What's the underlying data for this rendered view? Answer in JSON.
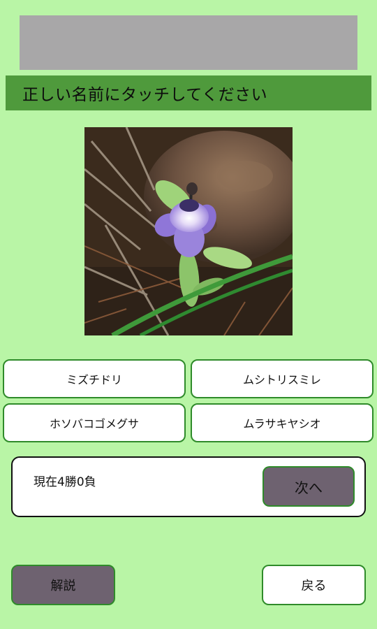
{
  "prompt": "正しい名前にタッチしてください",
  "choices": [
    "ミズチドリ",
    "ムシトリスミレ",
    "ホソバコゴメグサ",
    "ムラサキヤシオ"
  ],
  "result": {
    "text": "現在4勝0負",
    "next_label": "次へ"
  },
  "footer": {
    "explain_label": "解説",
    "back_label": "戻る"
  },
  "colors": {
    "background": "#b9f5a6",
    "prompt_bar": "#4f9a3c",
    "ad_banner": "#a8a7a8",
    "button_border": "#2f8b2a",
    "dark_button": "#6e6270"
  }
}
